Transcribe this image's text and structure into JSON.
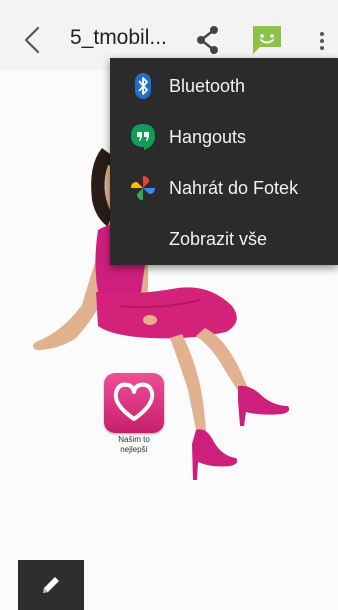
{
  "toolbar": {
    "title": "5_tmobil...",
    "icons": [
      "back-arrow-icon",
      "share-icon",
      "messaging-icon",
      "more-vert-icon"
    ],
    "message_accent": "#8bc34a"
  },
  "share_menu": {
    "items": [
      {
        "label": "Bluetooth",
        "icon": "bluetooth-icon"
      },
      {
        "label": "Hangouts",
        "icon": "hangouts-icon"
      },
      {
        "label": "Nahrát do Fotek",
        "icon": "google-photos-icon"
      },
      {
        "label": "Zobrazit vše",
        "icon": ""
      }
    ],
    "background": "#2b2b2b"
  },
  "image": {
    "app_tile_label_line1": "Našim to",
    "app_tile_label_line2": "nejlepší",
    "accent": "#d4217a"
  },
  "bottom": {
    "edit_icon": "pencil-icon"
  }
}
